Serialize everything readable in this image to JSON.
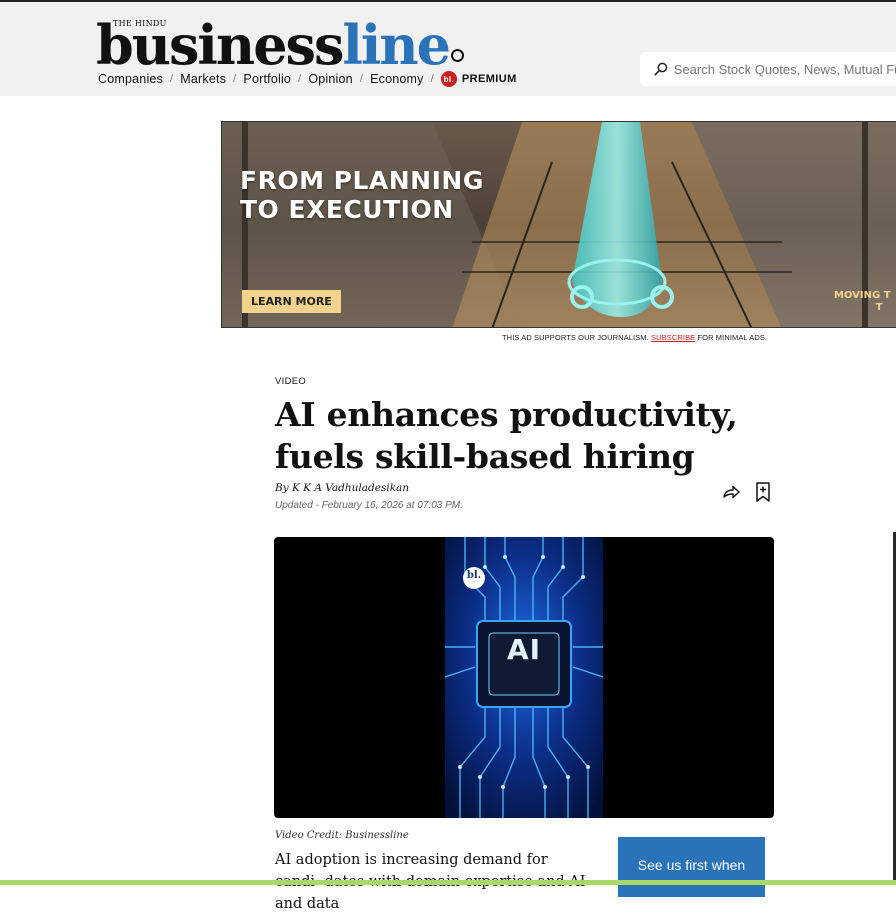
{
  "header": {
    "publisher_small": "THE HINDU",
    "brand_part1": "business",
    "brand_part2": "line",
    "nav": [
      {
        "label": "Companies"
      },
      {
        "label": "Markets"
      },
      {
        "label": "Portfolio"
      },
      {
        "label": "Opinion"
      },
      {
        "label": "Economy"
      }
    ],
    "premium_badge": "bl.",
    "premium_label": "PREMIUM",
    "search_placeholder": "Search Stock Quotes, News, Mutual Fu"
  },
  "ad": {
    "headline_line1": "FROM PLANNING",
    "headline_line2": "TO EXECUTION",
    "button_label": "LEARN MORE",
    "tagline_line1": "MOVING T",
    "tagline_line2": "T",
    "note_prefix": "THIS AD SUPPORTS OUR JOURNALISM.",
    "note_link": "SUBSCRIBE",
    "note_suffix": "FOR MINIMAL ADS."
  },
  "article": {
    "kicker": "VIDEO",
    "title": "AI enhances productivity, fuels skill-based hiring",
    "byline": "By K K A Vadhuladesikan",
    "updated": "Updated - February 16, 2026 at 07:03 PM.",
    "video": {
      "badge": "bl.",
      "chip_label": "AI"
    },
    "video_credit": "Video Credit: Businessline",
    "body": "AI adoption is increasing demand for candi- dates with domain expertise and AI and data"
  },
  "cta": {
    "label": "See us first when"
  },
  "colors": {
    "brand_blue": "#2b73b8",
    "premium_red": "#c91f25",
    "ad_button": "#f3d28c"
  }
}
